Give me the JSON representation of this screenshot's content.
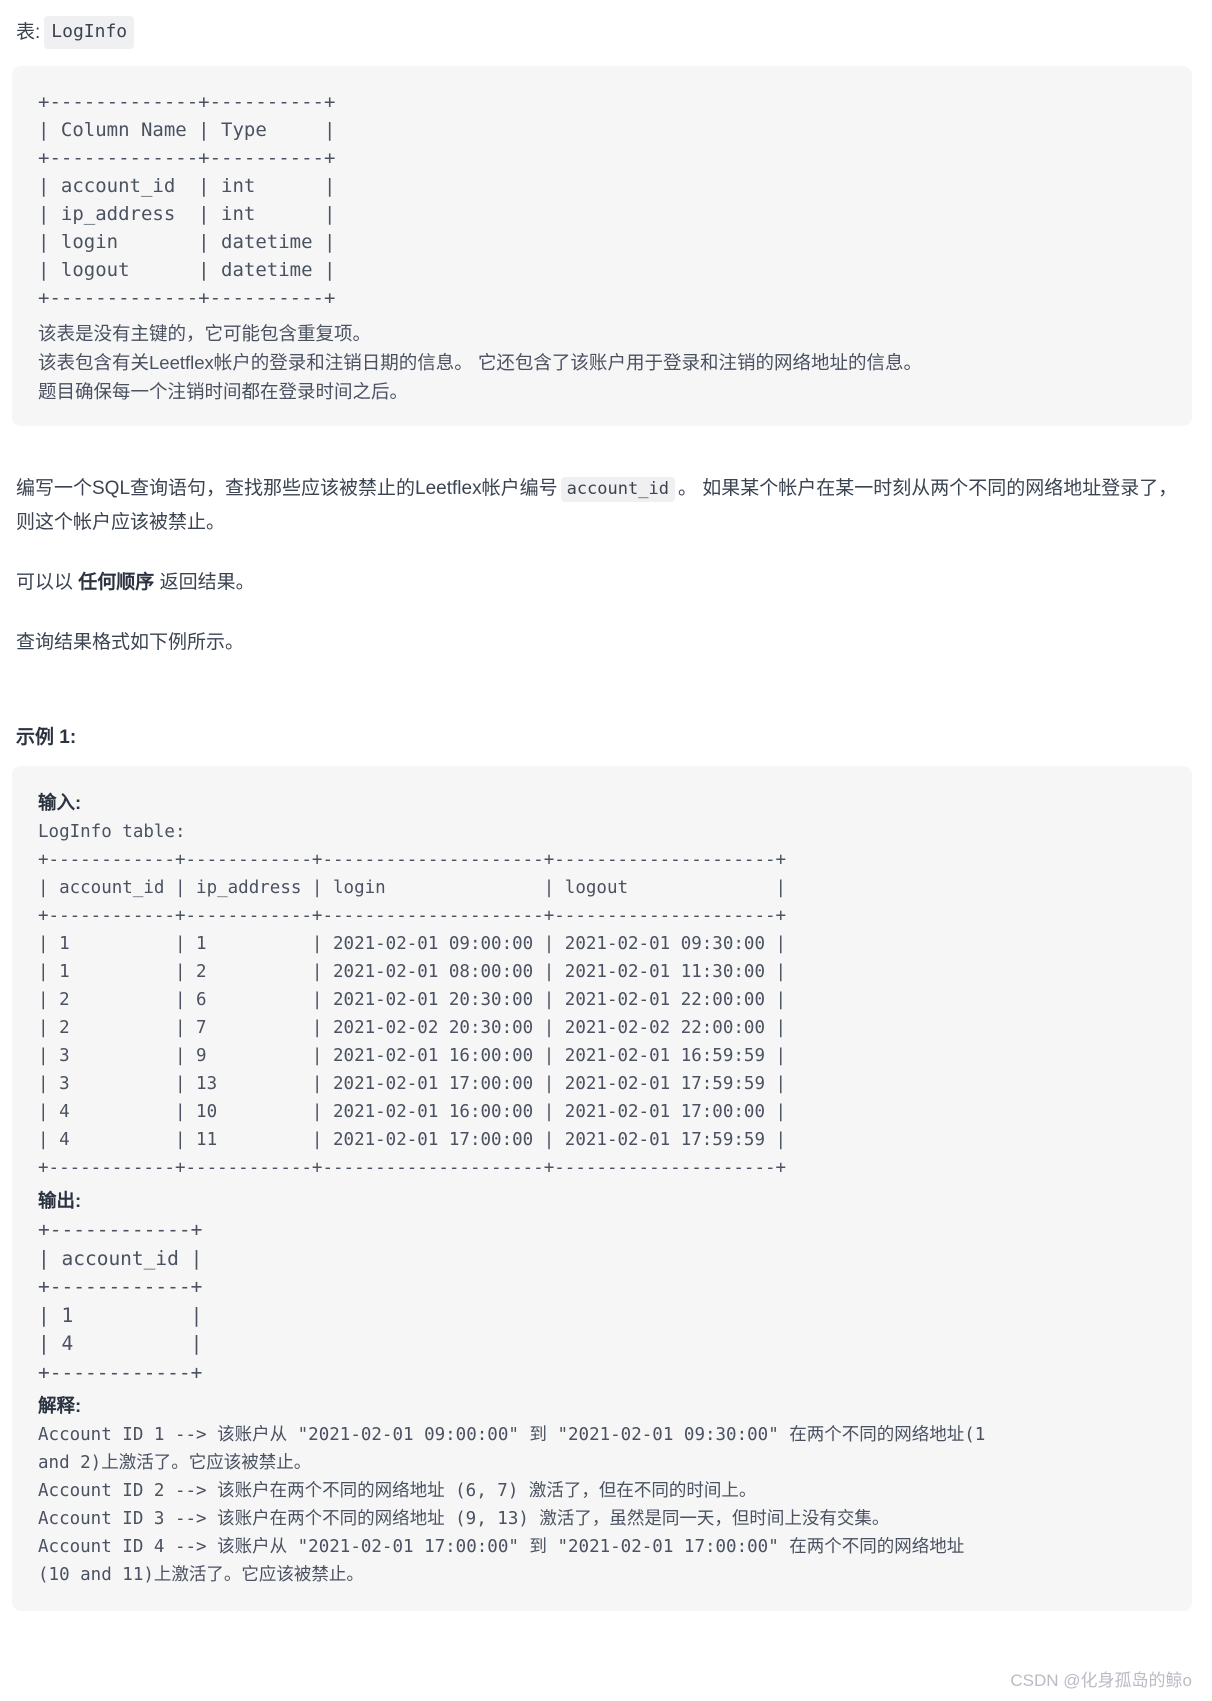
{
  "table_label": {
    "prefix": "表:",
    "name": "LogInfo"
  },
  "schema_panel": {
    "ascii_table": "+-------------+----------+\n| Column Name | Type     |\n+-------------+----------+\n| account_id  | int      |\n| ip_address  | int      |\n| login       | datetime |\n| logout      | datetime |\n+-------------+----------+",
    "notes": [
      "该表是没有主键的，它可能包含重复项。",
      "该表包含有关Leetflex帐户的登录和注销日期的信息。 它还包含了该账户用于登录和注销的网络地址的信息。",
      "题目确保每一个注销时间都在登录时间之后。"
    ]
  },
  "question": {
    "line1_before_code": "编写一个SQL查询语句，查找那些应该被禁止的Leetflex帐户编号",
    "code": "account_id",
    "line1_after_code": "。 如果某个帐户在某一时刻从两个不同的网络地址登录了，则这个帐户应该被禁止。",
    "order_prefix": "可以以",
    "order_bold": "任何顺序",
    "order_suffix": "返回结果。",
    "format_note": "查询结果格式如下例所示。"
  },
  "example": {
    "heading": "示例 1:",
    "input_label": "输入:",
    "input_table_caption": "LogInfo table:",
    "input_table": "+------------+------------+---------------------+---------------------+\n| account_id | ip_address | login               | logout              |\n+------------+------------+---------------------+---------------------+\n| 1          | 1          | 2021-02-01 09:00:00 | 2021-02-01 09:30:00 |\n| 1          | 2          | 2021-02-01 08:00:00 | 2021-02-01 11:30:00 |\n| 2          | 6          | 2021-02-01 20:30:00 | 2021-02-01 22:00:00 |\n| 2          | 7          | 2021-02-02 20:30:00 | 2021-02-02 22:00:00 |\n| 3          | 9          | 2021-02-01 16:00:00 | 2021-02-01 16:59:59 |\n| 3          | 13         | 2021-02-01 17:00:00 | 2021-02-01 17:59:59 |\n| 4          | 10         | 2021-02-01 16:00:00 | 2021-02-01 17:00:00 |\n| 4          | 11         | 2021-02-01 17:00:00 | 2021-02-01 17:59:59 |\n+------------+------------+---------------------+---------------------+",
    "output_label": "输出:",
    "output_table": "+------------+\n| account_id |\n+------------+\n| 1          |\n| 4          |\n+------------+",
    "explanation_label": "解释:",
    "explanation_lines": "Account ID 1 --> 该账户从 \"2021-02-01 09:00:00\" 到 \"2021-02-01 09:30:00\" 在两个不同的网络地址(1\nand 2)上激活了。它应该被禁止。\nAccount ID 2 --> 该账户在两个不同的网络地址 (6, 7) 激活了，但在不同的时间上。\nAccount ID 3 --> 该账户在两个不同的网络地址 (9, 13) 激活了，虽然是同一天，但时间上没有交集。\nAccount ID 4 --> 该账户从 \"2021-02-01 17:00:00\" 到 \"2021-02-01 17:00:00\" 在两个不同的网络地址\n(10 and 11)上激活了。它应该被禁止。"
  },
  "watermark": "CSDN @化身孤岛的鲸o",
  "colors": {
    "panel_bg": "#f6f6f7",
    "text": "#3b4351",
    "mono_text": "#4a5160",
    "code_chip_bg": "#f0f0f2",
    "watermark": "#b9bcc4"
  }
}
